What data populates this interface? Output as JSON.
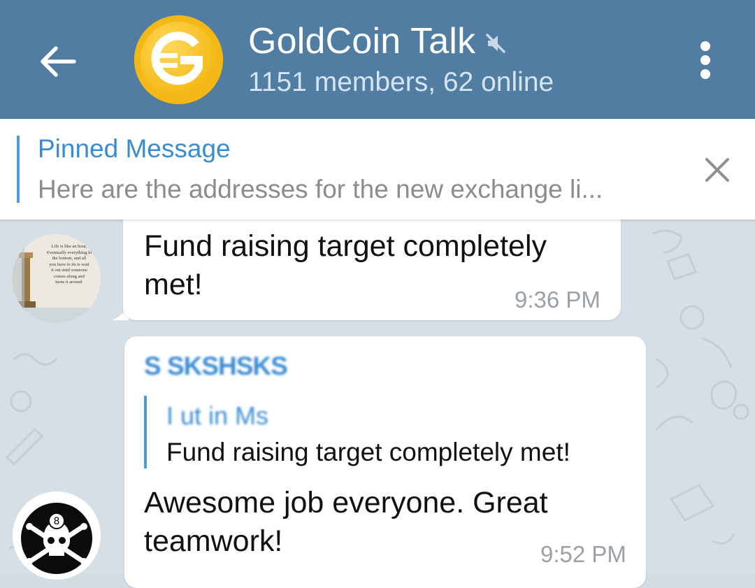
{
  "header": {
    "back_icon": "arrow-left-icon",
    "avatar_icon": "goldcoin-logo",
    "title": "GoldCoin Talk",
    "mute_icon": "muted-speaker-icon",
    "subtitle": "1151 members, 62 online",
    "menu_icon": "more-vertical-icon",
    "color": "#517da2"
  },
  "pinned": {
    "title": "Pinned Message",
    "text": "Here are the addresses for the new exchange li...",
    "close_icon": "close-icon",
    "accent_color": "#4f9bd9"
  },
  "messages": [
    {
      "avatar_icon": "quote-image-avatar",
      "avatar_quote": [
        "Life is like an hour,",
        "Eventually everything hi",
        "the bottom, and all",
        "you have to do is wait",
        "it out until someone",
        "comes along and",
        "turns it around."
      ],
      "text": "Fund raising target completely met!",
      "time": "9:36 PM"
    },
    {
      "avatar_icon": "eight-ball-skull-avatar",
      "sender": "S SKSHSKS",
      "reply": {
        "name": "I ut  in  Ms",
        "text": "Fund raising target completely met!"
      },
      "text": "Awesome job everyone.  Great teamwork!",
      "time": "9:52 PM"
    }
  ]
}
